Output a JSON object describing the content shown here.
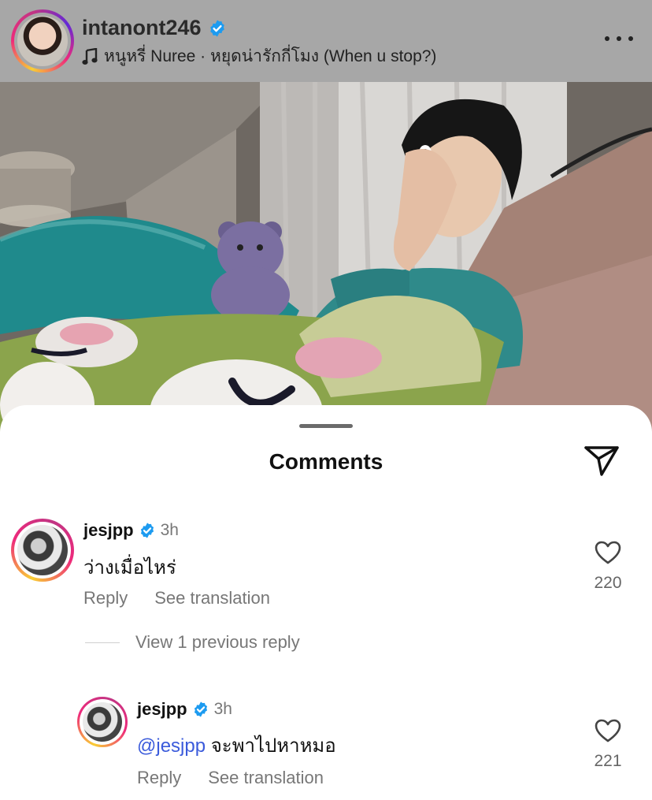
{
  "post_header": {
    "username": "intanont246",
    "verified": true,
    "music": "หนูหรี่ Nuree · หยุดน่ารักกี่โมง (When u stop?)"
  },
  "comments_sheet": {
    "title": "Comments",
    "comments": [
      {
        "username": "jesjpp",
        "verified": true,
        "time": "3h",
        "text": "ว่างเมื่อไหร่",
        "reply_label": "Reply",
        "translate_label": "See translation",
        "likes": "220"
      }
    ],
    "view_replies_label": "View 1 previous reply",
    "replies": [
      {
        "username": "jesjpp",
        "verified": true,
        "time": "3h",
        "mention": "@jesjpp",
        "text": " จะพาไปหาหมอ",
        "reply_label": "Reply",
        "translate_label": "See translation",
        "likes": "221"
      }
    ]
  },
  "colors": {
    "verified_blue": "#1d9bf0",
    "mention_blue": "#3b5bdb",
    "header_dim": "#a7a7a7"
  },
  "icons": [
    "verified-icon",
    "music-note-icon",
    "more-icon",
    "share-icon",
    "heart-icon"
  ]
}
